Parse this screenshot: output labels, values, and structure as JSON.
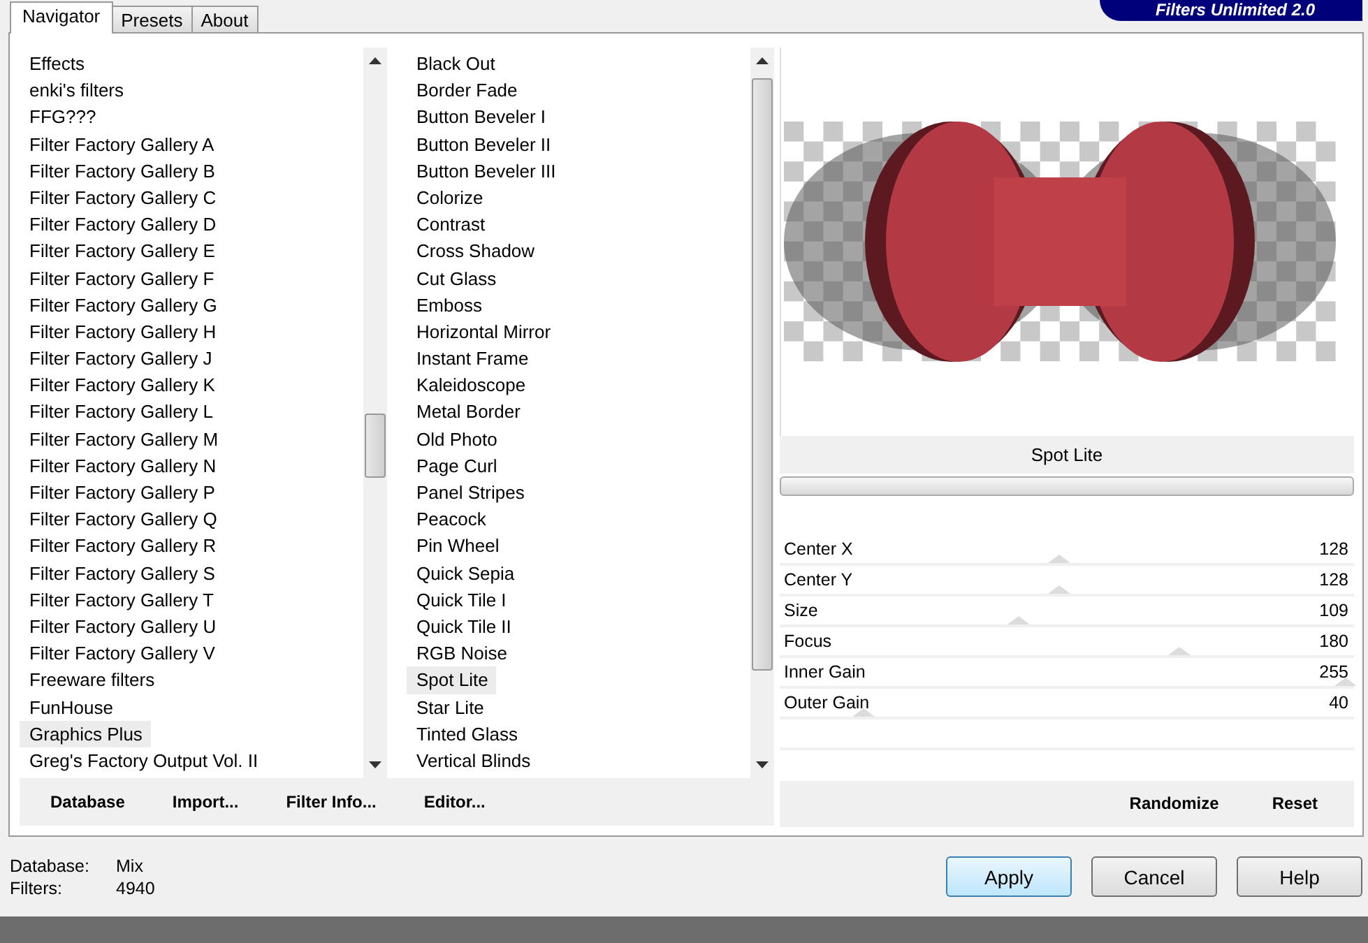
{
  "tabs": [
    {
      "label": "Navigator",
      "selected": true
    },
    {
      "label": "Presets",
      "selected": false
    },
    {
      "label": "About",
      "selected": false
    }
  ],
  "banner": {
    "title": "Filters Unlimited 2.0"
  },
  "categories": [
    {
      "label": "Effects",
      "selected": false
    },
    {
      "label": "enki's filters",
      "selected": false
    },
    {
      "label": "FFG???",
      "selected": false
    },
    {
      "label": "Filter Factory Gallery A",
      "selected": false
    },
    {
      "label": "Filter Factory Gallery B",
      "selected": false
    },
    {
      "label": "Filter Factory Gallery C",
      "selected": false
    },
    {
      "label": "Filter Factory Gallery D",
      "selected": false
    },
    {
      "label": "Filter Factory Gallery E",
      "selected": false
    },
    {
      "label": "Filter Factory Gallery F",
      "selected": false
    },
    {
      "label": "Filter Factory Gallery G",
      "selected": false
    },
    {
      "label": "Filter Factory Gallery H",
      "selected": false
    },
    {
      "label": "Filter Factory Gallery J",
      "selected": false
    },
    {
      "label": "Filter Factory Gallery K",
      "selected": false
    },
    {
      "label": "Filter Factory Gallery L",
      "selected": false
    },
    {
      "label": "Filter Factory Gallery M",
      "selected": false
    },
    {
      "label": "Filter Factory Gallery N",
      "selected": false
    },
    {
      "label": "Filter Factory Gallery P",
      "selected": false
    },
    {
      "label": "Filter Factory Gallery Q",
      "selected": false
    },
    {
      "label": "Filter Factory Gallery R",
      "selected": false
    },
    {
      "label": "Filter Factory Gallery S",
      "selected": false
    },
    {
      "label": "Filter Factory Gallery T",
      "selected": false
    },
    {
      "label": "Filter Factory Gallery U",
      "selected": false
    },
    {
      "label": "Filter Factory Gallery V",
      "selected": false
    },
    {
      "label": "Freeware filters",
      "selected": false
    },
    {
      "label": "FunHouse",
      "selected": false
    },
    {
      "label": "Graphics Plus",
      "selected": true
    },
    {
      "label": "Greg's Factory Output Vol. II",
      "selected": false
    }
  ],
  "filters": [
    {
      "label": "Black Out",
      "selected": false
    },
    {
      "label": "Border Fade",
      "selected": false
    },
    {
      "label": "Button Beveler I",
      "selected": false
    },
    {
      "label": "Button Beveler II",
      "selected": false
    },
    {
      "label": "Button Beveler III",
      "selected": false
    },
    {
      "label": "Colorize",
      "selected": false
    },
    {
      "label": "Contrast",
      "selected": false
    },
    {
      "label": "Cross Shadow",
      "selected": false
    },
    {
      "label": "Cut Glass",
      "selected": false
    },
    {
      "label": "Emboss",
      "selected": false
    },
    {
      "label": "Horizontal Mirror",
      "selected": false
    },
    {
      "label": "Instant Frame",
      "selected": false
    },
    {
      "label": "Kaleidoscope",
      "selected": false
    },
    {
      "label": "Metal Border",
      "selected": false
    },
    {
      "label": "Old Photo",
      "selected": false
    },
    {
      "label": "Page Curl",
      "selected": false
    },
    {
      "label": "Panel Stripes",
      "selected": false
    },
    {
      "label": "Peacock",
      "selected": false
    },
    {
      "label": "Pin Wheel",
      "selected": false
    },
    {
      "label": "Quick Sepia",
      "selected": false
    },
    {
      "label": "Quick Tile I",
      "selected": false
    },
    {
      "label": "Quick Tile II",
      "selected": false
    },
    {
      "label": "RGB Noise",
      "selected": false
    },
    {
      "label": "Spot Lite",
      "selected": true
    },
    {
      "label": "Star Lite",
      "selected": false
    },
    {
      "label": "Tinted Glass",
      "selected": false
    },
    {
      "label": "Vertical Blinds",
      "selected": false
    }
  ],
  "navigator_buttons": [
    "Database",
    "Import...",
    "Filter Info...",
    "Editor..."
  ],
  "filter_name": "Spot Lite",
  "parameters": [
    {
      "label": "Center X",
      "value": "128",
      "level": 0.5
    },
    {
      "label": "Center Y",
      "value": "128",
      "level": 0.5
    },
    {
      "label": "Size",
      "value": "109",
      "level": 0.43
    },
    {
      "label": "Focus",
      "value": "180",
      "level": 0.71
    },
    {
      "label": "Inner Gain",
      "value": "255",
      "level": 1
    },
    {
      "label": "Outer Gain",
      "value": "40",
      "level": 0.16
    }
  ],
  "filter_buttons": [
    "Randomize",
    "Reset"
  ],
  "status": [
    {
      "label": "Database:",
      "value": "Mix"
    },
    {
      "label": "Filters:",
      "value": "4940"
    }
  ],
  "dialog_buttons": [
    {
      "label": "Apply",
      "default": true
    },
    {
      "label": "Cancel",
      "default": false
    },
    {
      "label": "Help",
      "default": false
    }
  ]
}
